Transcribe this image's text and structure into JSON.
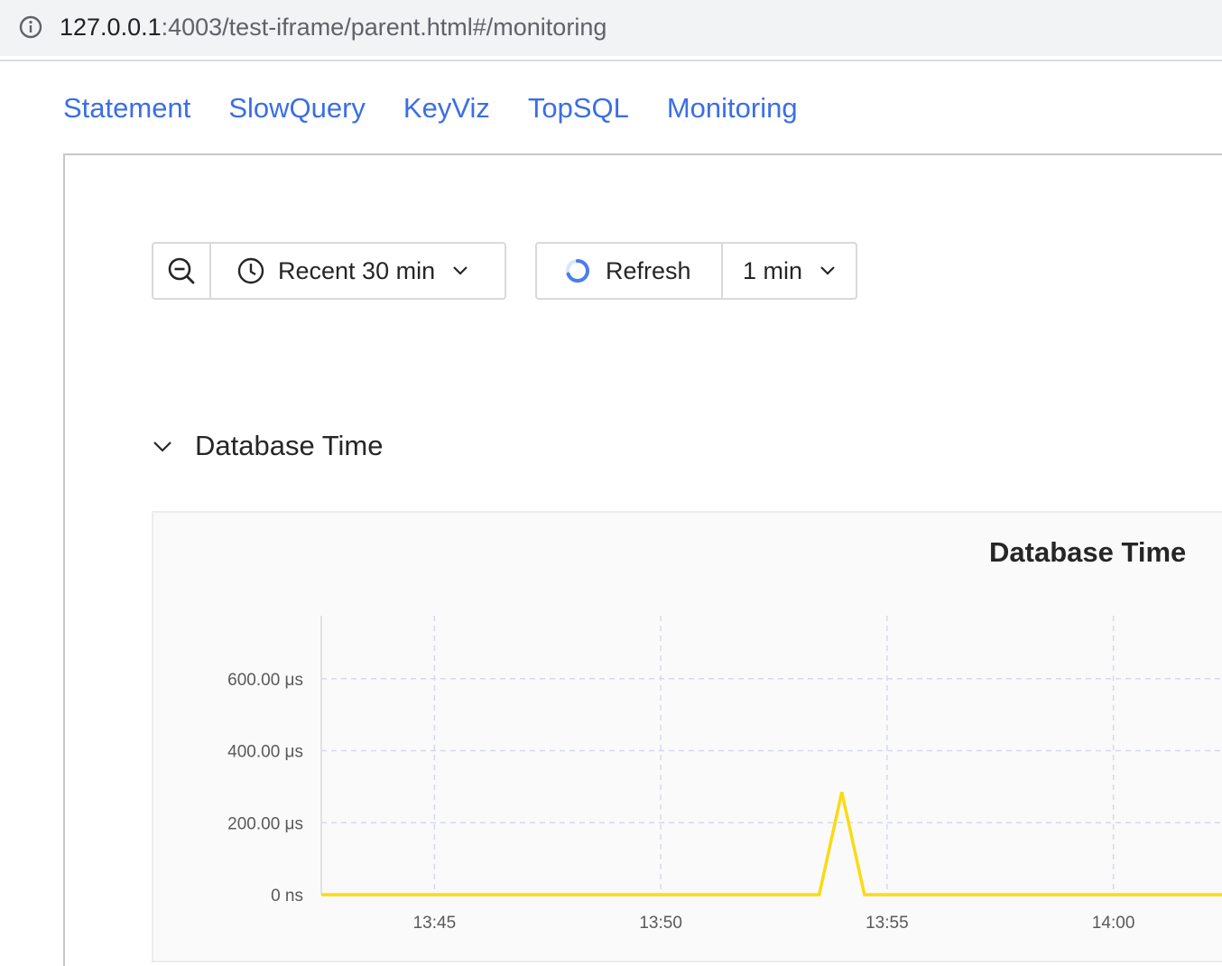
{
  "browser": {
    "url_host": "127.0.0.1",
    "url_rest": ":4003/test-iframe/parent.html#/monitoring",
    "info_icon": "info-circle-icon"
  },
  "nav": {
    "items": [
      {
        "label": "Statement"
      },
      {
        "label": "SlowQuery"
      },
      {
        "label": "KeyViz"
      },
      {
        "label": "TopSQL"
      },
      {
        "label": "Monitoring"
      }
    ]
  },
  "toolbar": {
    "zoom_out_icon": "zoom-out-icon",
    "time_range_icon": "clock-icon",
    "time_range_label": "Recent 30 min",
    "refresh_icon": "loading-spinner-icon",
    "refresh_label": "Refresh",
    "interval_label": "1 min"
  },
  "section": {
    "collapse_icon": "chevron-down-icon",
    "title": "Database Time"
  },
  "chart_data": {
    "type": "line",
    "title": "Database Time",
    "x_tick_labels": [
      "13:45",
      "13:50",
      "13:55",
      "14:00"
    ],
    "y_tick_labels": [
      "0 ns",
      "200.00 μs",
      "400.00 μs",
      "600.00 μs"
    ],
    "y_ticks_us": [
      0,
      200,
      400,
      600
    ],
    "x_ticks_min": [
      0,
      5,
      10,
      15
    ],
    "ylim_us": [
      0,
      775
    ],
    "xlim_min": [
      -2.5,
      17.4
    ],
    "grid": true,
    "series": [
      {
        "color": "#fadb14",
        "points": [
          {
            "x": -2.5,
            "y": 0
          },
          {
            "x": 8.5,
            "y": 0
          },
          {
            "x": 9.0,
            "y": 285
          },
          {
            "x": 9.5,
            "y": 0
          },
          {
            "x": 17.4,
            "y": 0
          }
        ]
      }
    ]
  }
}
